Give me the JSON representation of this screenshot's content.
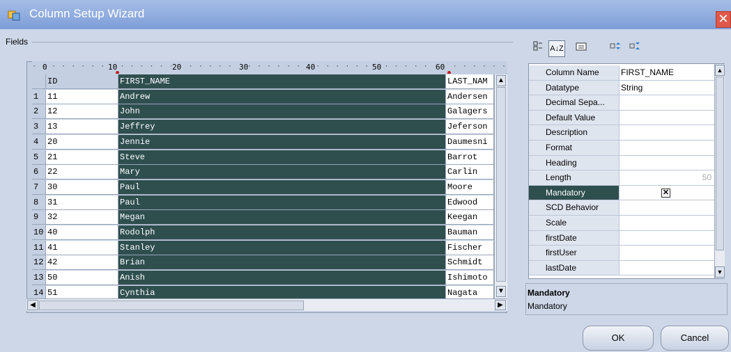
{
  "window": {
    "title": "Column Setup Wizard",
    "close_glyph": "✕"
  },
  "fields": {
    "label": "Fields",
    "ruler": [
      "0",
      "10",
      "20",
      "30",
      "40",
      "50",
      "60"
    ],
    "headers": {
      "id": "ID",
      "first": "FIRST_NAME",
      "last": "LAST_NAM"
    },
    "rows": [
      {
        "n": "1",
        "id": "11",
        "first": "Andrew",
        "last": "Andersen"
      },
      {
        "n": "2",
        "id": "12",
        "first": "John",
        "last": "Galagers"
      },
      {
        "n": "3",
        "id": "13",
        "first": "Jeffrey",
        "last": "Jeferson"
      },
      {
        "n": "4",
        "id": "20",
        "first": "Jennie",
        "last": "Daumesni"
      },
      {
        "n": "5",
        "id": "21",
        "first": "Steve",
        "last": "Barrot"
      },
      {
        "n": "6",
        "id": "22",
        "first": "Mary",
        "last": "Carlin"
      },
      {
        "n": "7",
        "id": "30",
        "first": "Paul",
        "last": "Moore"
      },
      {
        "n": "8",
        "id": "31",
        "first": "Paul",
        "last": "Edwood"
      },
      {
        "n": "9",
        "id": "32",
        "first": "Megan",
        "last": "Keegan"
      },
      {
        "n": "10",
        "id": "40",
        "first": "Rodolph",
        "last": "Bauman"
      },
      {
        "n": "11",
        "id": "41",
        "first": "Stanley",
        "last": "Fischer"
      },
      {
        "n": "12",
        "id": "42",
        "first": "Brian",
        "last": "Schmidt"
      },
      {
        "n": "13",
        "id": "50",
        "first": "Anish",
        "last": "Ishimoto"
      },
      {
        "n": "14",
        "id": "51",
        "first": "Cynthia",
        "last": "Nagata"
      }
    ]
  },
  "toolbar": {
    "categorized": "categorized-icon",
    "alphabetical": "A↓Z",
    "property_pages": "property-pages-icon",
    "expand": "expand-icon",
    "collapse": "collapse-icon"
  },
  "properties": {
    "rows": [
      {
        "name": "Column Name",
        "value": "FIRST_NAME"
      },
      {
        "name": "Datatype",
        "value": "String"
      },
      {
        "name": "Decimal Sepa...",
        "value": ""
      },
      {
        "name": "Default Value",
        "value": ""
      },
      {
        "name": "Description",
        "value": ""
      },
      {
        "name": "Format",
        "value": ""
      },
      {
        "name": "Heading",
        "value": ""
      },
      {
        "name": "Length",
        "value": "50"
      },
      {
        "name": "Mandatory",
        "value": ""
      },
      {
        "name": "SCD Behavior",
        "value": ""
      },
      {
        "name": "Scale",
        "value": ""
      },
      {
        "name": "firstDate",
        "value": ""
      },
      {
        "name": "firstUser",
        "value": ""
      },
      {
        "name": "lastDate",
        "value": ""
      }
    ],
    "selected": "Mandatory",
    "mandatory_checked": true
  },
  "description": {
    "title": "Mandatory",
    "text": "Mandatory"
  },
  "buttons": {
    "ok": "OK",
    "cancel": "Cancel"
  }
}
